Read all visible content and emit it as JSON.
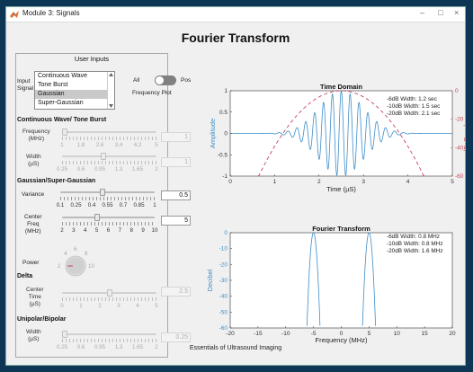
{
  "window": {
    "title": "Module 3: Signals",
    "minimize": "–",
    "maximize": "□",
    "close": "×"
  },
  "page_title": "Fourier Transform",
  "footer": "Essentials of Ultrasound Imaging",
  "user_inputs": {
    "title": "User Inputs",
    "input_signal_label": "Input\nSignal",
    "signals": [
      "Continuous Wave",
      "Tone Burst",
      "Gaussian",
      "Super-Gaussian"
    ],
    "selected_signal": "Gaussian",
    "toggle": {
      "left_label": "All",
      "right_label": "Pos",
      "caption": "Frequency Plot"
    },
    "cw_tb": {
      "heading": "Continuous Wave/ Tone Burst",
      "frequency": {
        "label": "Frequency\n(MHz)",
        "value": "1",
        "ticks": [
          "1",
          "1.8",
          "2.6",
          "3.4",
          "4.2",
          "5"
        ],
        "fraction": 0.0
      },
      "width": {
        "label": "Width\n(µS)",
        "value": "1",
        "ticks": [
          "0.25",
          "0.6",
          "0.95",
          "1.3",
          "1.65",
          "2"
        ],
        "fraction": 0.43
      }
    },
    "gaussian": {
      "heading": "Gaussian/Super-Gaussian",
      "variance": {
        "label": "Variance",
        "value": "0.5",
        "ticks": [
          "0.1",
          "0.25",
          "0.4",
          "0.55",
          "0.7",
          "0.85",
          "1"
        ],
        "fraction": 0.44
      },
      "center_freq": {
        "label": "Center\nFreq\n(MHz)",
        "value": "5",
        "ticks": [
          "2",
          "3",
          "4",
          "5",
          "6",
          "7",
          "8",
          "9",
          "10"
        ],
        "fraction": 0.375
      },
      "power": {
        "label": "Power",
        "ticks": [
          "2",
          "4",
          "6",
          "8",
          "10"
        ]
      }
    },
    "delta": {
      "heading": "Delta",
      "center_time": {
        "label": "Center\nTime\n(µS)",
        "value": "2.5",
        "ticks": [
          "0",
          "1",
          "2",
          "3",
          "4",
          "5"
        ],
        "fraction": 0.5
      }
    },
    "unipolar": {
      "heading": "Unipolar/Bipolar",
      "width": {
        "label": "Width\n(µS)",
        "value": "0.25",
        "ticks": [
          "0.25",
          "0.6",
          "0.95",
          "1.3",
          "1.65",
          "2"
        ],
        "fraction": 0.0
      }
    }
  },
  "colors": {
    "signal": "#3d8ec9",
    "envelope": "#c8455c",
    "axis_left": "#3d8ec9",
    "axis_right": "#c8455c"
  },
  "chart_data": [
    {
      "type": "line",
      "title": "Time Domain",
      "xlabel": "Time (µS)",
      "ylabel": "Amplitude",
      "y2label": "dB: Envelope",
      "xlim": [
        0,
        5
      ],
      "ylim": [
        -1,
        1
      ],
      "y2lim": [
        -60,
        0
      ],
      "xticks": [
        "0",
        "1",
        "2",
        "3",
        "4",
        "5"
      ],
      "yticks": [
        "-1",
        "-0.5",
        "0",
        "0.5",
        "1"
      ],
      "y2ticks": [
        "-60",
        "-40",
        "-20",
        "0"
      ],
      "series": [
        {
          "kind": "gaussian_pulse",
          "center": 2.5,
          "sigma": 0.5,
          "frequency_mhz": 5
        },
        {
          "kind": "envelope_db",
          "center": 2.5,
          "sigma": 0.5
        }
      ],
      "annotations": [
        "-6dB Width: 1.2 sec",
        "-10dB Width: 1.5 sec",
        "-20dB Width: 2.1 sec"
      ],
      "grid": false
    },
    {
      "type": "line",
      "title": "Fourier Transform",
      "xlabel": "Frequency (MHz)",
      "ylabel": "Decibel",
      "xlim": [
        -20,
        20
      ],
      "ylim": [
        -60,
        0
      ],
      "xticks": [
        "-20",
        "-15",
        "-10",
        "-5",
        "0",
        "5",
        "10",
        "15",
        "20"
      ],
      "yticks": [
        "-60",
        "-50",
        "-40",
        "-30",
        "-20",
        "-10",
        "0"
      ],
      "series": [
        {
          "kind": "gaussian_spectrum_db",
          "centers": [
            -5,
            5
          ],
          "sigma": 0.5
        }
      ],
      "annotations": [
        "-6dB Width: 0.8 MHz",
        "-10dB Width: 0.8 MHz",
        "-20dB Width: 1.6 MHz"
      ],
      "grid": false
    }
  ]
}
